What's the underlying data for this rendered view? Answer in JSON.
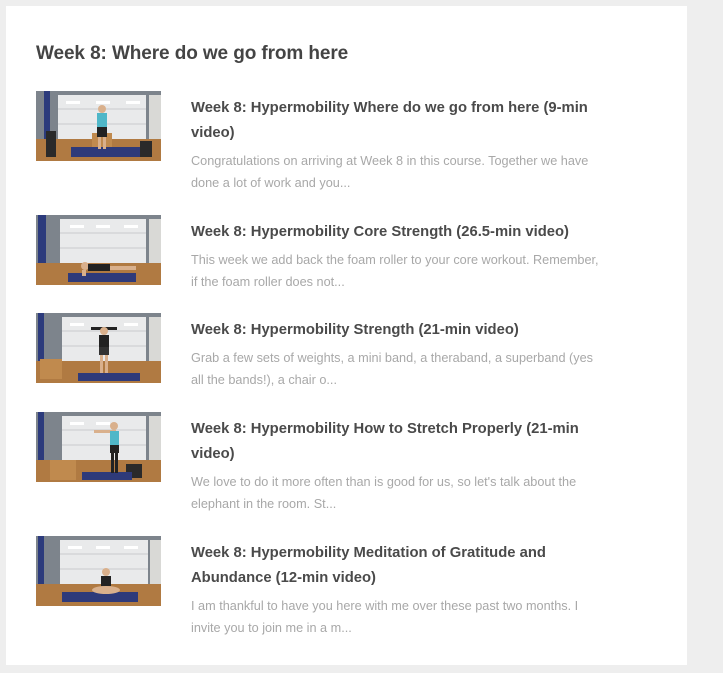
{
  "section": {
    "title": "Week 8: Where do we go from here"
  },
  "lessons": [
    {
      "title": "Week 8: Hypermobility Where do we go from here (9-min video)",
      "excerpt": "Congratulations on arriving at Week 8 in this course. Together we have done a lot of work and you...",
      "thumbnail": "instructor-seated-on-box"
    },
    {
      "title": "Week 8: Hypermobility Core Strength (26.5-min video)",
      "excerpt": "This week we add back the foam roller to your core workout. Remember, if the foam roller does not...",
      "thumbnail": "instructor-lying-on-mat"
    },
    {
      "title": "Week 8: Hypermobility Strength (21-min video)",
      "excerpt": "Grab a few sets of weights, a mini band, a theraband, a superband (yes all the bands!), a chair o...",
      "thumbnail": "instructor-standing-with-band"
    },
    {
      "title": "Week 8: Hypermobility How to Stretch Properly (21-min video)",
      "excerpt": "We love to do it more often than is good for us, so let's talk about the elephant in the room. St...",
      "thumbnail": "instructor-stretching-arms"
    },
    {
      "title": "Week 8: Hypermobility Meditation of Gratitude and Abundance (12-min video)",
      "excerpt": "I am thankful to have you here with me over these past two months. I invite you to join me in a m...",
      "thumbnail": "instructor-seated-meditating"
    }
  ],
  "colors": {
    "title_text": "#4a4a4a",
    "excerpt_text": "#a8a8a8",
    "garage_door": "#e9eaeb",
    "floor_wood": "#b07a42",
    "mat": "#2e3a7a"
  }
}
